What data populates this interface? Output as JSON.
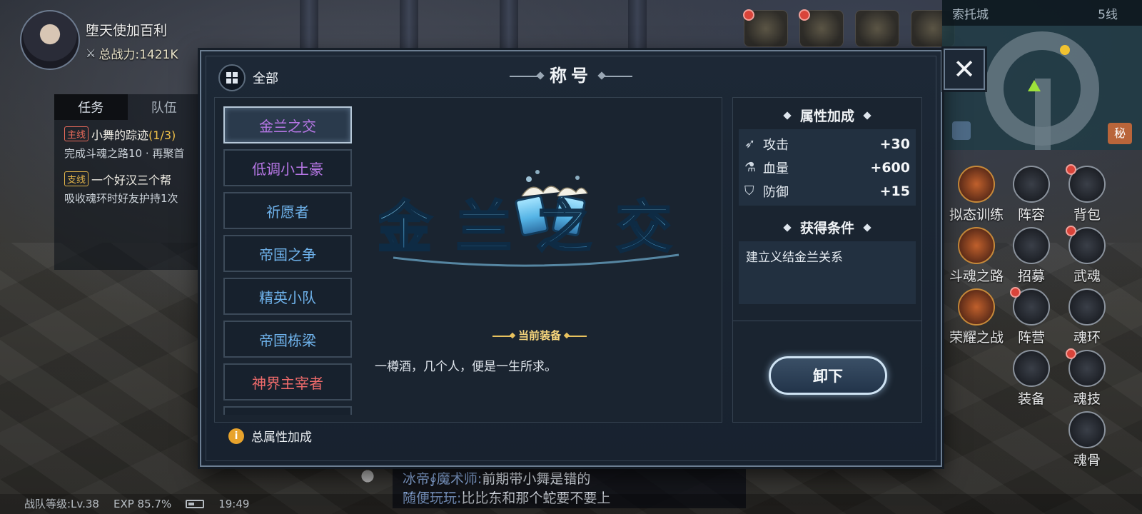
{
  "player": {
    "name": "堕天使加百利",
    "power_label": "总战力:1421K"
  },
  "quest": {
    "tabs": [
      "任务",
      "队伍"
    ],
    "items": [
      {
        "tag": "主线",
        "title": "小舞的踪迹",
        "progress": "(1/3)",
        "desc": "完成斗魂之路10 · 再聚首"
      },
      {
        "tag": "支线",
        "title": "一个好汉三个帮",
        "progress": "",
        "desc": "吸收魂环时好友护持1次"
      }
    ]
  },
  "minimap": {
    "location": "索托城",
    "line": "5线",
    "badge": "秘"
  },
  "side_menu": [
    {
      "label": "拟态训练",
      "icon": "training-icon",
      "dot": false
    },
    {
      "label": "阵容",
      "icon": "lineup-icon",
      "dot": false
    },
    {
      "label": "背包",
      "icon": "backpack-icon",
      "dot": true
    },
    {
      "label": "斗魂之路",
      "icon": "soul-road-icon",
      "dot": false
    },
    {
      "label": "招募",
      "icon": "recruit-icon",
      "dot": false
    },
    {
      "label": "武魂",
      "icon": "martial-soul-icon",
      "dot": true
    },
    {
      "label": "荣耀之战",
      "icon": "glory-war-icon",
      "dot": false
    },
    {
      "label": "阵营",
      "icon": "camp-icon",
      "dot": true
    },
    {
      "label": "魂环",
      "icon": "soul-ring-icon",
      "dot": false
    },
    {
      "label": "装备",
      "icon": "equipment-icon",
      "dot": false
    },
    {
      "label": "魂技",
      "icon": "soul-skill-icon",
      "dot": true
    },
    {
      "label": "魂骨",
      "icon": "soul-bone-icon",
      "dot": false
    }
  ],
  "status_bar": {
    "team_level": "战队等级:Lv.38",
    "exp": "EXP 85.7%",
    "time": "19:49"
  },
  "chat": [
    {
      "name": "冰帝∮魔术师:",
      "msg": "前期带小舞是错的"
    },
    {
      "name": "随便玩玩:",
      "msg": "比比东和那个蛇要不要上"
    }
  ],
  "modal": {
    "title": "称号",
    "filter_label": "全部",
    "close": "✕",
    "titles": [
      {
        "name": "金兰之交",
        "color": "#b777e6",
        "selected": true
      },
      {
        "name": "低调小土豪",
        "color": "#b777e6",
        "selected": false
      },
      {
        "name": "祈愿者",
        "color": "#6fb3ec",
        "selected": false
      },
      {
        "name": "帝国之争",
        "color": "#6fb3ec",
        "selected": false
      },
      {
        "name": "精英小队",
        "color": "#6fb3ec",
        "selected": false
      },
      {
        "name": "帝国栋梁",
        "color": "#6fb3ec",
        "selected": false
      },
      {
        "name": "神界主宰者",
        "color": "#ef6b6b",
        "selected": false
      },
      {
        "name": "",
        "color": "#ef6b6b",
        "selected": false
      }
    ],
    "emblem_text": "金兰之交",
    "equipped_label": "当前装备",
    "flavor_text": "一樽酒，几个人，便是一生所求。",
    "attributes_title": "属性加成",
    "attributes": [
      {
        "icon": "attack-icon",
        "name": "攻击",
        "value": "+30"
      },
      {
        "icon": "hp-icon",
        "name": "血量",
        "value": "+600"
      },
      {
        "icon": "defense-icon",
        "name": "防御",
        "value": "+15"
      }
    ],
    "condition_title": "获得条件",
    "condition_text": "建立义结金兰关系",
    "unequip_label": "卸下",
    "total_attr_label": "总属性加成"
  }
}
